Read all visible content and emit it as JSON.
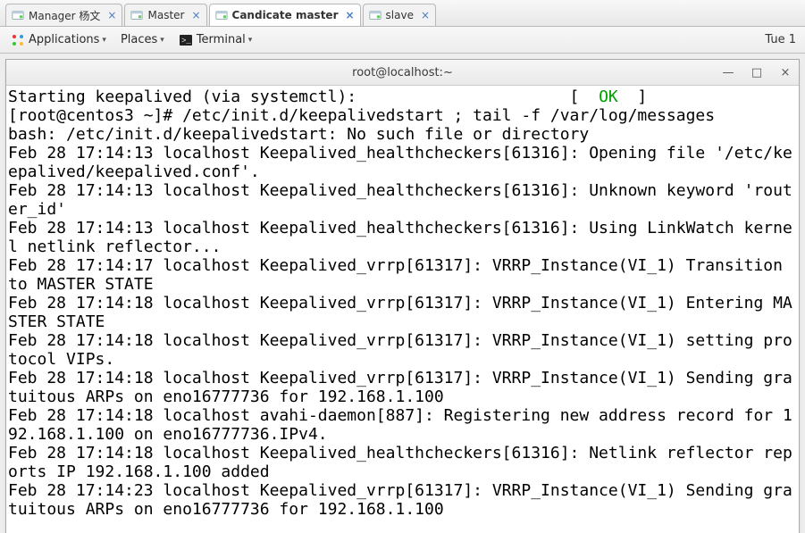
{
  "tabs": [
    {
      "label": "Manager 杨文",
      "active": false
    },
    {
      "label": "Master",
      "active": false
    },
    {
      "label": "Candicate master",
      "active": true
    },
    {
      "label": "slave",
      "active": false
    }
  ],
  "menubar": {
    "applications": "Applications",
    "places": "Places",
    "terminal": "Terminal"
  },
  "clock": "Tue 1",
  "terminal": {
    "title": "root@localhost:~",
    "ok_label": "OK",
    "lines_before_ok": "Starting keepalived (via systemctl):                      [  ",
    "lines_after_ok": "  ]\n[root@centos3 ~]# /etc/init.d/keepalivedstart ; tail -f /var/log/messages\nbash: /etc/init.d/keepalivedstart: No such file or directory\nFeb 28 17:14:13 localhost Keepalived_healthcheckers[61316]: Opening file '/etc/keepalived/keepalived.conf'.\nFeb 28 17:14:13 localhost Keepalived_healthcheckers[61316]: Unknown keyword 'router_id'\nFeb 28 17:14:13 localhost Keepalived_healthcheckers[61316]: Using LinkWatch kernel netlink reflector...\nFeb 28 17:14:17 localhost Keepalived_vrrp[61317]: VRRP_Instance(VI_1) Transition to MASTER STATE\nFeb 28 17:14:18 localhost Keepalived_vrrp[61317]: VRRP_Instance(VI_1) Entering MASTER STATE\nFeb 28 17:14:18 localhost Keepalived_vrrp[61317]: VRRP_Instance(VI_1) setting protocol VIPs.\nFeb 28 17:14:18 localhost Keepalived_vrrp[61317]: VRRP_Instance(VI_1) Sending gratuitous ARPs on eno16777736 for 192.168.1.100\nFeb 28 17:14:18 localhost avahi-daemon[887]: Registering new address record for 192.168.1.100 on eno16777736.IPv4.\nFeb 28 17:14:18 localhost Keepalived_healthcheckers[61316]: Netlink reflector reports IP 192.168.1.100 added\nFeb 28 17:14:23 localhost Keepalived_vrrp[61317]: VRRP_Instance(VI_1) Sending gratuitous ARPs on eno16777736 for 192.168.1.100"
  }
}
